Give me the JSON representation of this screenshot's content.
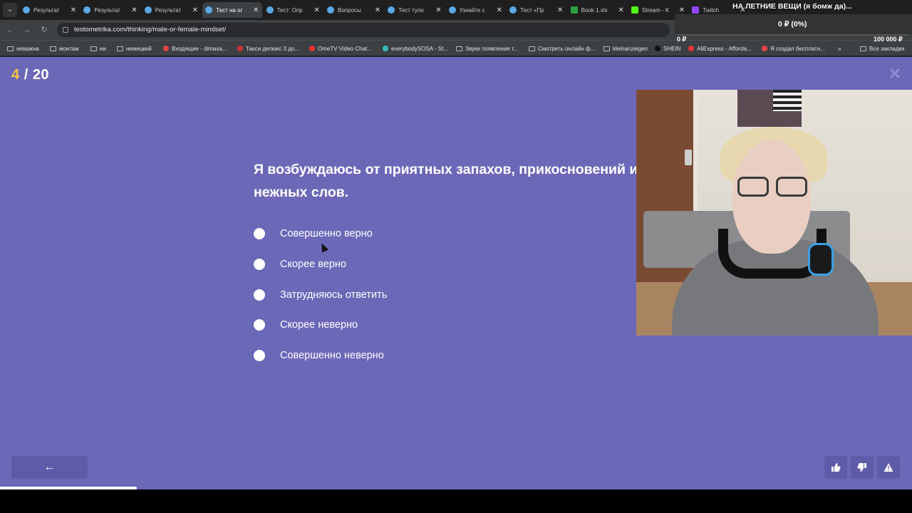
{
  "browser": {
    "tabs": [
      {
        "title": "Результат",
        "favicon": "blue-circle-icon",
        "active": false
      },
      {
        "title": "Результат",
        "favicon": "blue-circle-icon",
        "active": false
      },
      {
        "title": "Результат",
        "favicon": "blue-circle-icon",
        "active": false
      },
      {
        "title": "Тест на ог",
        "favicon": "blue-circle-icon",
        "active": true
      },
      {
        "title": "Тест: Опр",
        "favicon": "blue-circle-icon",
        "active": false
      },
      {
        "title": "Вопросы",
        "favicon": "blue-circle-icon",
        "active": false
      },
      {
        "title": "Тест тупо",
        "favicon": "blue-circle-icon",
        "active": false
      },
      {
        "title": "Узнайте с",
        "favicon": "blue-circle-icon",
        "active": false
      },
      {
        "title": "Тест «Пр",
        "favicon": "blue-circle-icon",
        "active": false
      },
      {
        "title": "Book 1.xls",
        "favicon": "sheets-icon",
        "active": false
      },
      {
        "title": "Stream - K",
        "favicon": "kick-icon",
        "active": false
      },
      {
        "title": "Twitch",
        "favicon": "twitch-icon",
        "active": false
      }
    ],
    "url": "testometrika.com/thinking/male-or-female-mindset/",
    "bookmarks": [
      "неважна",
      "монтаж",
      "ии",
      "немецкий",
      "Входящие - dimaxa...",
      "Такси делюкс 3 до...",
      "OmeTV Video Chat...",
      "everybodySOSA - St...",
      "Звуки появления т...",
      "Смотреть онлайн ф...",
      "kleinanzeigen",
      "SHEIN",
      "AliExpress - Afforda...",
      "Я создал бесплатн..."
    ],
    "bookmarks_more": "»",
    "all_bookmarks": "Все закладки"
  },
  "donation_overlay": {
    "title": "НА ЛЕТНИЕ ВЕЩИ (я бомж да)...",
    "amount": "0 ₽ (0%)",
    "min_label": "0 ₽",
    "max_label": "100 000 ₽",
    "progress": 0
  },
  "quiz": {
    "current": "4",
    "separator": "/",
    "total": "20",
    "question": "Я возбуждаюсь от приятных запахов, прикосновений и нежных слов.",
    "options": [
      "Совершенно верно",
      "Скорее верно",
      "Затрудняюсь ответить",
      "Скорее неверно",
      "Совершенно неверно"
    ],
    "progress_fraction": 0.15,
    "back_label": "←",
    "accent_color": "#f5c542",
    "background_color": "#6b68b8"
  }
}
